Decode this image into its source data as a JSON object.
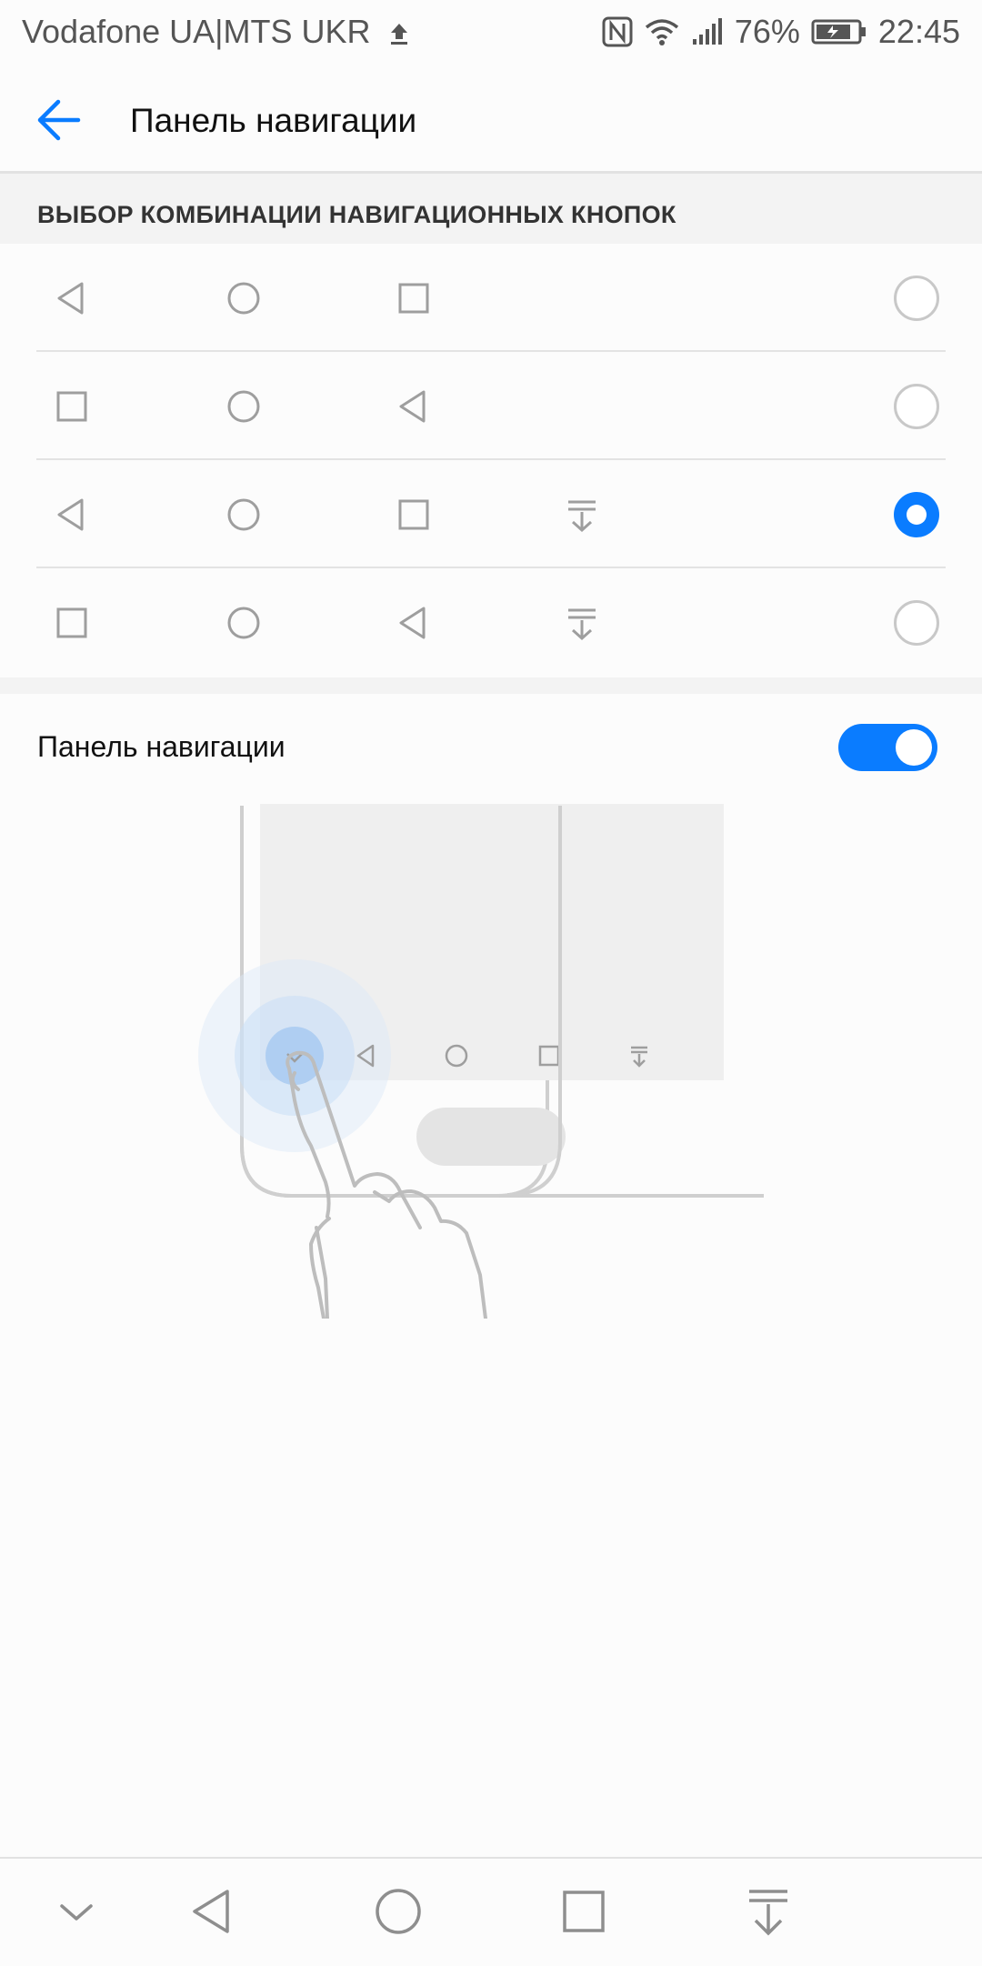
{
  "status_bar": {
    "carrier": "Vodafone UA|MTS UKR",
    "battery": "76%",
    "time": "22:45",
    "icons": [
      "upload-icon",
      "nfc-icon",
      "wifi-icon",
      "signal-icon",
      "battery-icon"
    ]
  },
  "app_bar": {
    "back_icon": "arrow-left-icon",
    "title": "Панель навигации"
  },
  "section": {
    "header": "ВЫБОР КОМБИНАЦИИ НАВИГАЦИОННЫХ КНОПОК"
  },
  "options": [
    {
      "keys": [
        "back",
        "home",
        "recent"
      ],
      "selected": false
    },
    {
      "keys": [
        "recent",
        "home",
        "back"
      ],
      "selected": false
    },
    {
      "keys": [
        "back",
        "home",
        "recent",
        "notifications"
      ],
      "selected": true
    },
    {
      "keys": [
        "recent",
        "home",
        "back",
        "notifications"
      ],
      "selected": false
    }
  ],
  "toggle": {
    "label": "Панель навигации",
    "enabled": true
  },
  "illustration": {
    "keys": [
      "hide",
      "back",
      "home",
      "recent",
      "notifications"
    ]
  },
  "nav_bar": {
    "buttons": [
      "hide-bar",
      "back",
      "home",
      "recent",
      "notifications"
    ]
  },
  "colors": {
    "accent": "#0a7cff",
    "icon_gray": "#9e9e9e",
    "divider": "#e3e3e3",
    "section_bg": "#f3f3f3"
  }
}
